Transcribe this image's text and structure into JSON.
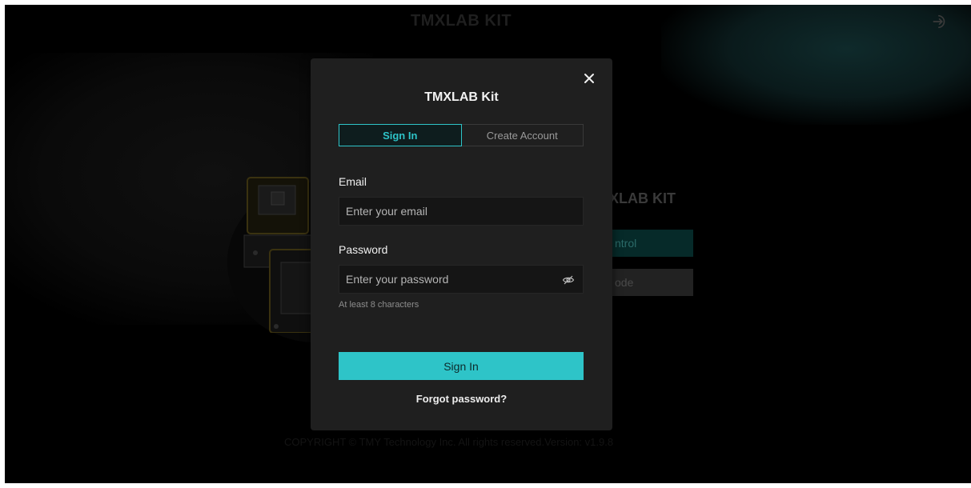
{
  "background": {
    "app_title": "TMXLAB KIT",
    "kit_heading_partial": "XLAB KIT",
    "primary_button_partial": "ntrol",
    "secondary_button_partial": "ode",
    "copyright": "COPYRIGHT © TMY Technology Inc. All rights reserved.Version: v1.9.8"
  },
  "modal": {
    "title": "TMXLAB Kit",
    "tabs": [
      {
        "label": "Sign In",
        "active": true
      },
      {
        "label": "Create Account",
        "active": false
      }
    ],
    "email": {
      "label": "Email",
      "value": "",
      "placeholder": "Enter your email"
    },
    "password": {
      "label": "Password",
      "value": "",
      "placeholder": "Enter your password",
      "hint": "At least 8 characters"
    },
    "submit_label": "Sign In",
    "forgot_label": "Forgot password?"
  },
  "icons": {
    "close": "close-icon",
    "eye": "eye-off-icon",
    "login": "login-icon"
  },
  "colors": {
    "accent": "#2ec4c8",
    "modal_bg": "#1f1f1f",
    "page_bg": "#000000"
  }
}
